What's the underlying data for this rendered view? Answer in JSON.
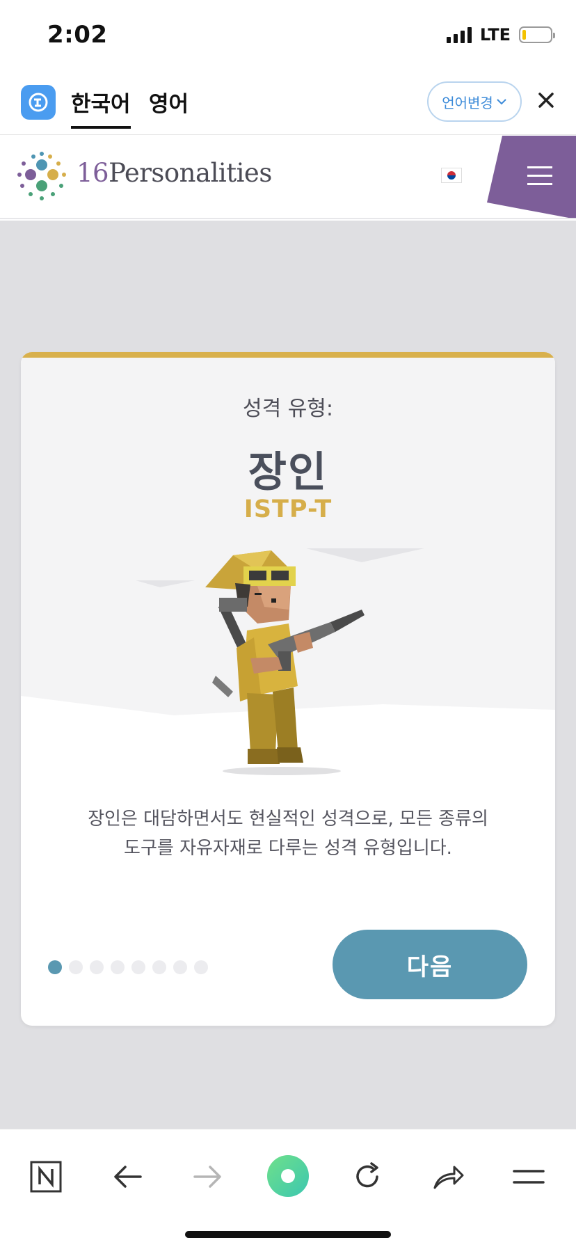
{
  "status_bar": {
    "time": "2:02",
    "network": "LTE",
    "battery_level": 0.12
  },
  "translator": {
    "tabs": [
      {
        "label": "한국어",
        "active": true
      },
      {
        "label": "영어",
        "active": false
      }
    ],
    "change_language_label": "언어변경",
    "close_icon": "close-icon",
    "app_icon": "papago-icon"
  },
  "site_header": {
    "logo_number": "16",
    "logo_word": "Personalities",
    "language_flag": "korea-flag-icon",
    "menu_icon": "hamburger-menu-icon",
    "menu_color": "#7d5e99"
  },
  "card": {
    "subtitle": "성격 유형:",
    "title": "장인",
    "type_code": "ISTP-T",
    "description_line1": "장인은 대담하면서도 현실적인 성격으로, 모든 종류의",
    "description_line2": "도구를 자유자재로 다루는 성격 유형입니다.",
    "accent_color": "#d6ae4a",
    "pagination": {
      "total": 8,
      "current": 1
    },
    "next_button_label": "다음",
    "next_button_color": "#5a98b1"
  },
  "browser_toolbar": {
    "items": [
      "naver-icon",
      "back-arrow-icon",
      "forward-arrow-icon",
      "green-dot-icon",
      "reload-icon",
      "share-icon",
      "menu-icon"
    ]
  }
}
